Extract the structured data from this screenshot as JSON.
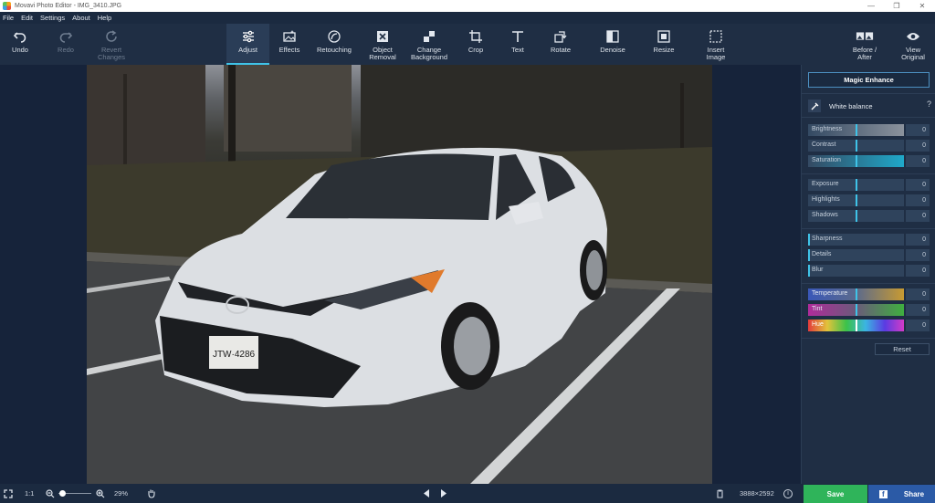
{
  "window": {
    "title": "Movavi Photo Editor - IMG_3410.JPG",
    "minimize": "—",
    "restore": "❐",
    "close": "✕"
  },
  "menu": [
    "File",
    "Edit",
    "Settings",
    "About",
    "Help"
  ],
  "toolbar": {
    "undo": "Undo",
    "redo": "Redo",
    "revert": "Revert\nChanges",
    "adjust": "Adjust",
    "effects": "Effects",
    "retouching": "Retouching",
    "object_removal": "Object\nRemoval",
    "change_background": "Change\nBackground",
    "crop": "Crop",
    "text": "Text",
    "rotate": "Rotate",
    "denoise": "Denoise",
    "resize": "Resize",
    "insert_image": "Insert\nImage",
    "before_after": "Before /\nAfter",
    "view_original": "View\nOriginal"
  },
  "photo": {
    "plate": "JTW·4286"
  },
  "panel": {
    "magic_enhance": "Magic Enhance",
    "white_balance": "White balance",
    "help": "?",
    "reset": "Reset",
    "sliders": [
      {
        "name": "Brightness",
        "value": "0"
      },
      {
        "name": "Contrast",
        "value": "0"
      },
      {
        "name": "Saturation",
        "value": "0"
      },
      {
        "name": "Exposure",
        "value": "0"
      },
      {
        "name": "Highlights",
        "value": "0"
      },
      {
        "name": "Shadows",
        "value": "0"
      },
      {
        "name": "Sharpness",
        "value": "0"
      },
      {
        "name": "Details",
        "value": "0"
      },
      {
        "name": "Blur",
        "value": "0"
      },
      {
        "name": "Temperature",
        "value": "0"
      },
      {
        "name": "Tint",
        "value": "0"
      },
      {
        "name": "Hue",
        "value": "0"
      }
    ]
  },
  "status": {
    "fit": "1:1",
    "zoom": "29%",
    "zoom_level": 0.1,
    "dimensions": "3888×2592",
    "info": "i",
    "save": "Save",
    "share": "Share",
    "fb": "f"
  },
  "colors": {
    "accent": "#3fc3e8",
    "save": "#2fb45a",
    "share": "#2b5aa6"
  }
}
